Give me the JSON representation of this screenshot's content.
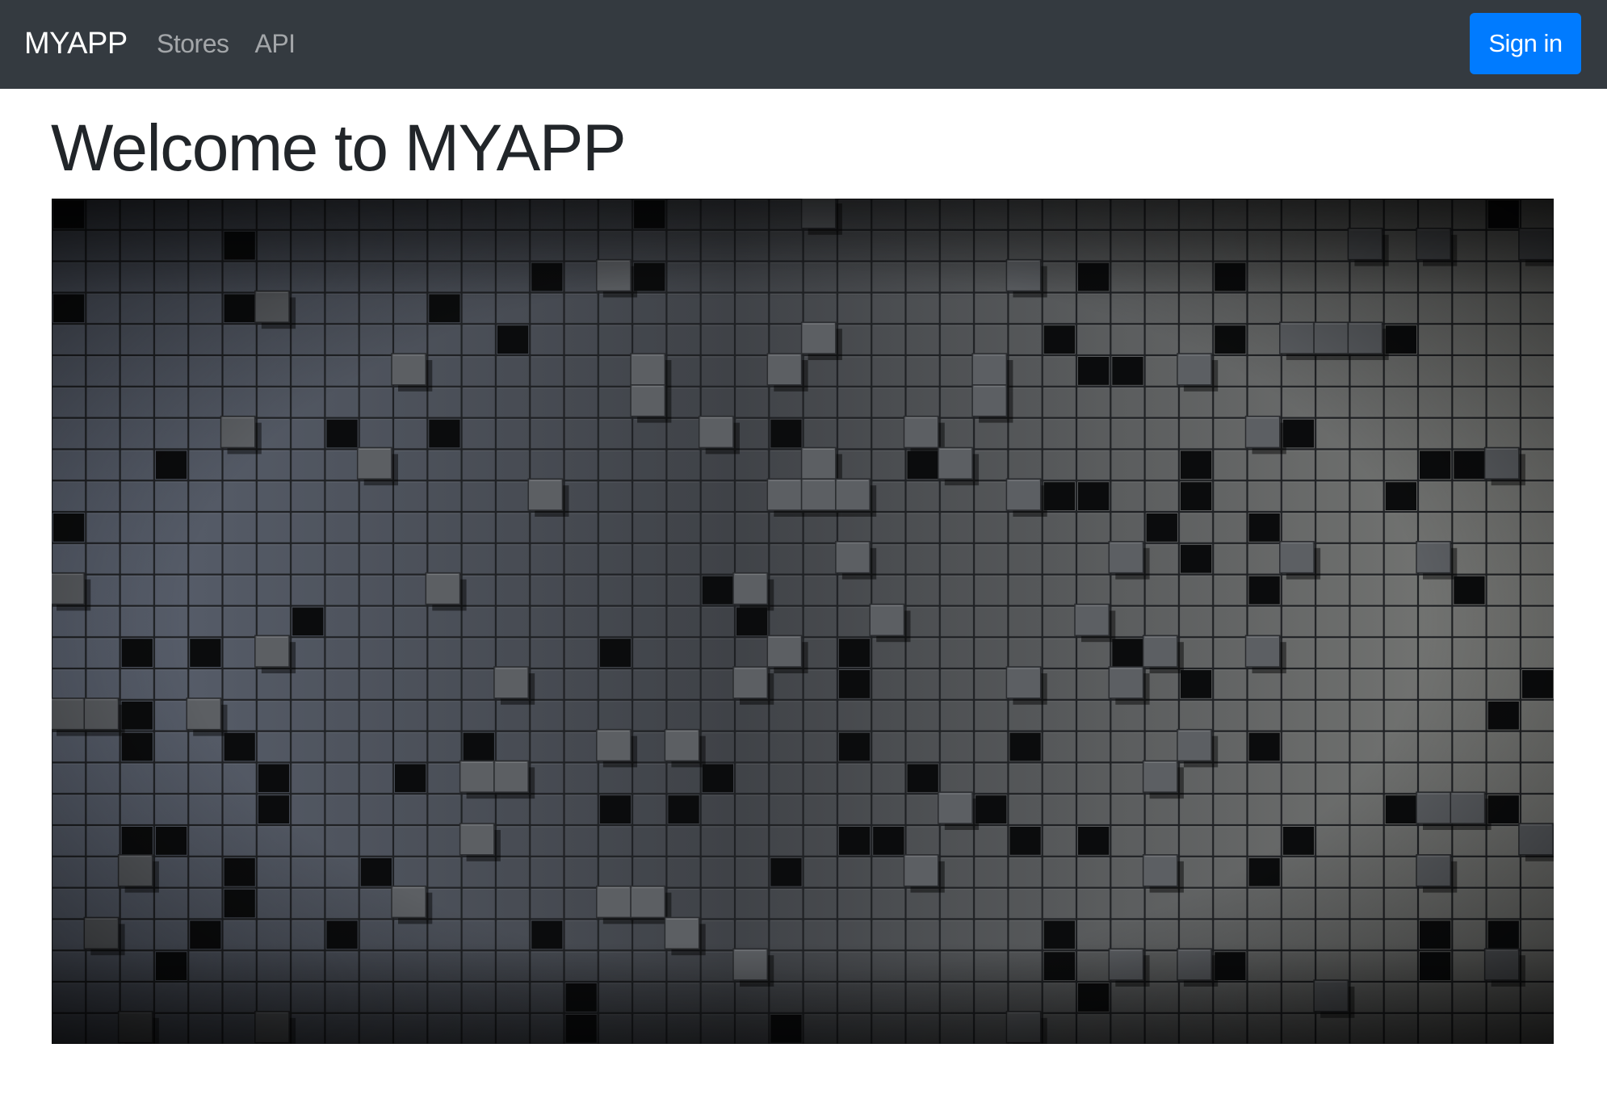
{
  "navbar": {
    "brand": "MYAPP",
    "links": [
      {
        "label": "Stores"
      },
      {
        "label": "API"
      }
    ],
    "signin_label": "Sign in",
    "background": "#343a40",
    "accent": "#007bff"
  },
  "main": {
    "title": "Welcome to MYAPP",
    "hero_image": {
      "icon": "abstract-cube-wall-image"
    }
  }
}
